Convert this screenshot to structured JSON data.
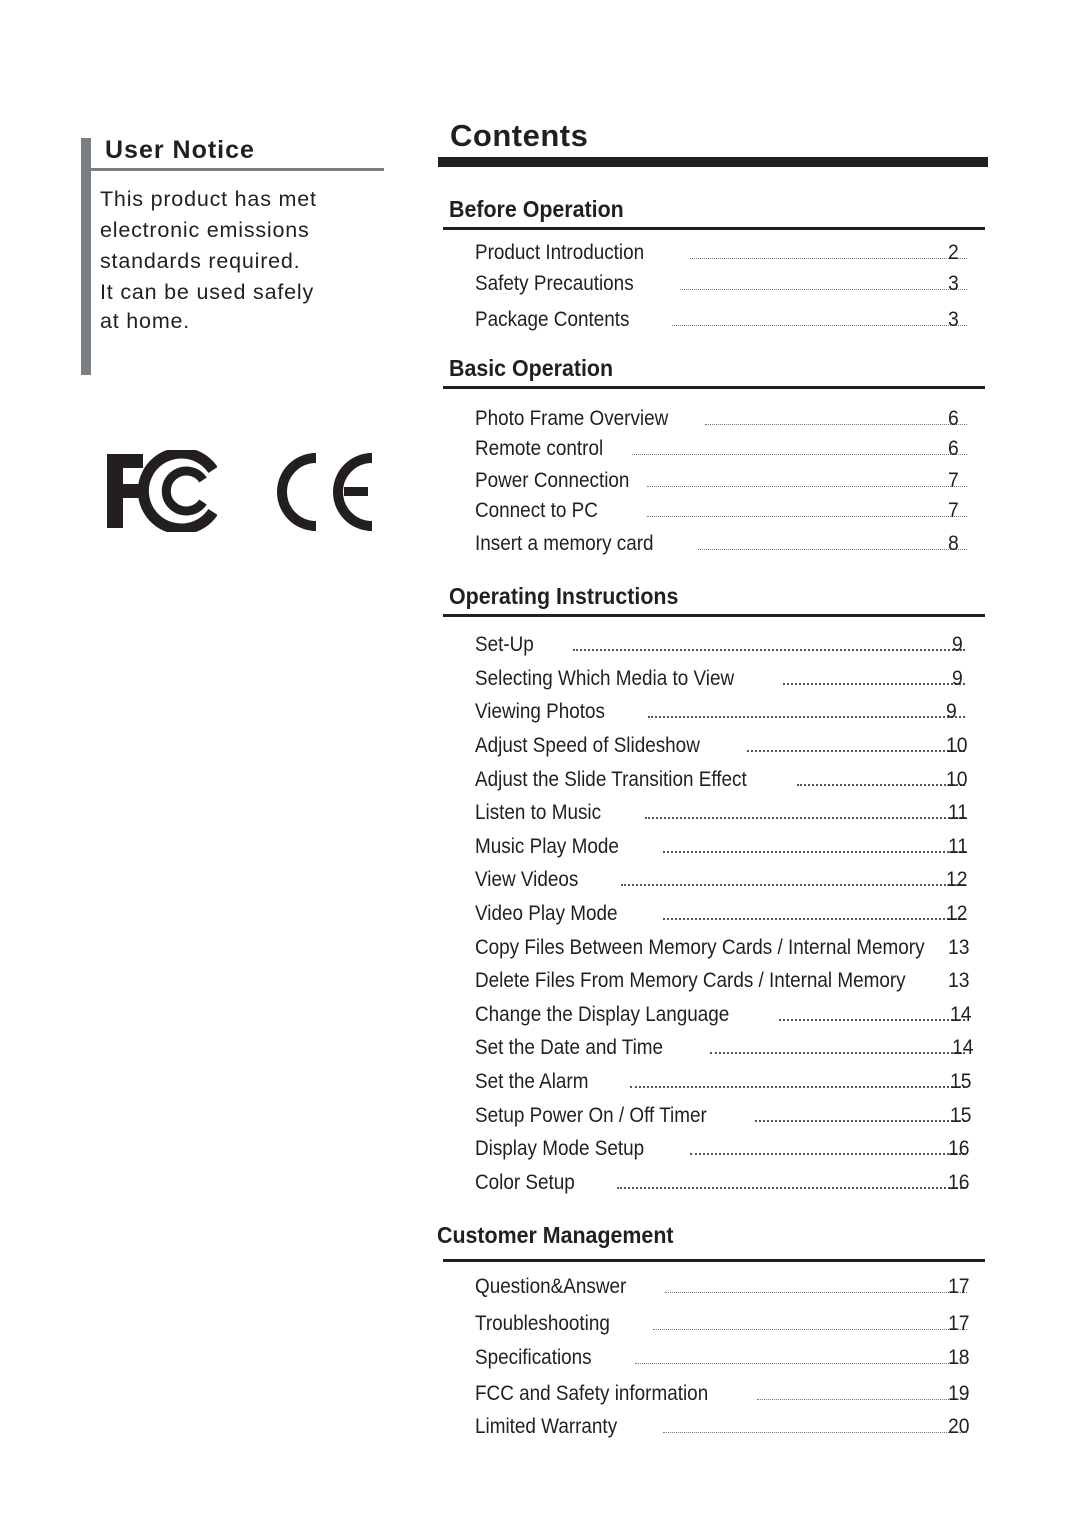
{
  "user_notice": {
    "title": "User Notice",
    "lines": [
      "This product has met",
      "electronic emissions",
      "standards required.",
      "It can be used safely",
      "at home."
    ]
  },
  "logos": [
    {
      "name": "fcc-logo",
      "label": "FC"
    },
    {
      "name": "ce-logo",
      "label": "CE"
    }
  ],
  "contents": {
    "title": "Contents",
    "sections": [
      {
        "title": "Before Operation",
        "entries": [
          {
            "label": "Product Introduction",
            "page": "2"
          },
          {
            "label": "Safety Precautions",
            "page": "3"
          },
          {
            "label": "Package Contents",
            "page": "3"
          }
        ]
      },
      {
        "title": "Basic Operation",
        "entries": [
          {
            "label": "Photo Frame Overview",
            "page": "6"
          },
          {
            "label": "Remote control",
            "page": "6"
          },
          {
            "label": "Power Connection",
            "page": "7"
          },
          {
            "label": "Connect to PC",
            "page": "7"
          },
          {
            "label": "Insert a memory card",
            "page": "8"
          }
        ]
      },
      {
        "title": "Operating Instructions",
        "entries": [
          {
            "label": "Set-Up",
            "page": "9"
          },
          {
            "label": "Selecting Which Media to View",
            "page": "9"
          },
          {
            "label": "Viewing Photos",
            "page": "9"
          },
          {
            "label": "Adjust Speed of Slideshow",
            "page": "10"
          },
          {
            "label": "Adjust the Slide Transition Effect",
            "page": "10"
          },
          {
            "label": "Listen to Music",
            "page": "11"
          },
          {
            "label": "Music Play Mode",
            "page": "11"
          },
          {
            "label": "View Videos",
            "page": "12"
          },
          {
            "label": "Video Play Mode",
            "page": "12"
          },
          {
            "label": "Copy Files Between Memory Cards / Internal Memory",
            "page": "13"
          },
          {
            "label": "Delete Files From Memory Cards / Internal Memory",
            "page": "13"
          },
          {
            "label": "Change the Display Language",
            "page": "14"
          },
          {
            "label": "Set the Date and Time",
            "page": "14"
          },
          {
            "label": "Set the Alarm",
            "page": "15"
          },
          {
            "label": "Setup Power On / Off Timer",
            "page": "15"
          },
          {
            "label": "Display Mode Setup",
            "page": "16"
          },
          {
            "label": "Color Setup",
            "page": "16"
          }
        ]
      },
      {
        "title": "Customer Management",
        "entries": [
          {
            "label": "Question&Answer",
            "page": "17"
          },
          {
            "label": "Troubleshooting",
            "page": "17"
          },
          {
            "label": "Specifications",
            "page": "18"
          },
          {
            "label": "FCC and Safety information",
            "page": "19"
          },
          {
            "label": "Limited Warranty",
            "page": "20"
          }
        ]
      }
    ]
  }
}
